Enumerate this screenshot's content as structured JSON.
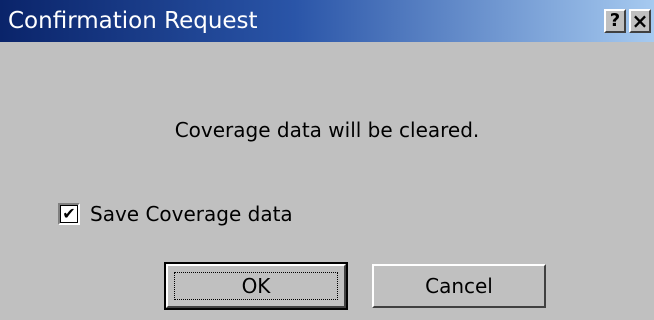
{
  "window": {
    "title": "Confirmation Request",
    "help_label": "?",
    "close_label": "×"
  },
  "message": "Coverage data will be cleared.",
  "save_option": {
    "label": "Save Coverage data",
    "checked": true,
    "check_glyph": "✔"
  },
  "buttons": {
    "ok_label": "OK",
    "cancel_label": "Cancel"
  },
  "colors": {
    "dialog_bg": "#c0c0c0",
    "titlebar_start": "#0a246a",
    "titlebar_end": "#a6caf0"
  }
}
